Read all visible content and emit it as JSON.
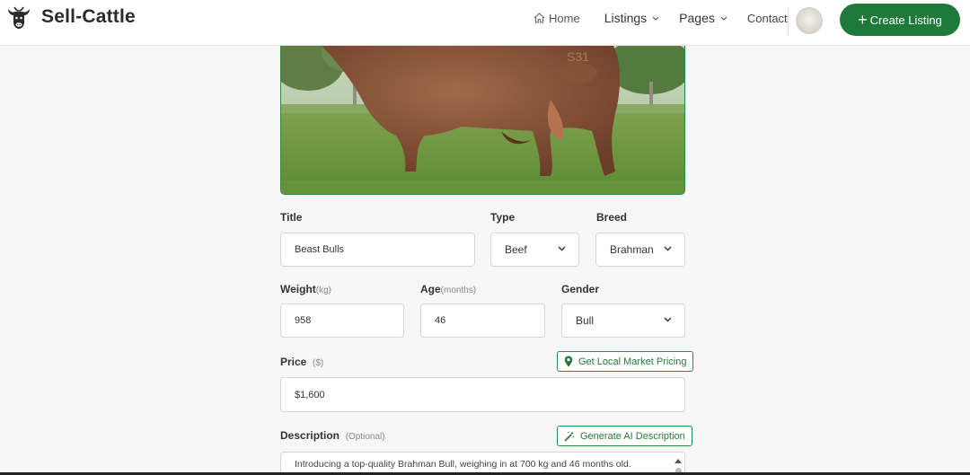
{
  "app": {
    "name": "Sell-Cattle"
  },
  "nav": {
    "home": "Home",
    "listings": "Listings",
    "pages": "Pages",
    "contact": "Contact",
    "create_listing": "Create Listing"
  },
  "form": {
    "title": {
      "label": "Title",
      "value": "Beast Bulls"
    },
    "type": {
      "label": "Type",
      "value": "Beef"
    },
    "breed": {
      "label": "Breed",
      "value": "Brahman"
    },
    "weight": {
      "label": "Weight",
      "unit": "(kg)",
      "value": "958"
    },
    "age": {
      "label": "Age",
      "unit": "(months)",
      "value": "46"
    },
    "gender": {
      "label": "Gender",
      "value": "Bull"
    },
    "price": {
      "label": "Price",
      "unit": "($)",
      "value": "$1,600",
      "market_button": "Get Local Market Pricing"
    },
    "description": {
      "label": "Description",
      "optional": "(Optional)",
      "ai_button": "Generate AI Description",
      "value": "Introducing a top-quality Brahman Bull, weighing in at 700 kg and 46 months old. Known for their heat tolerance, disease resistance, and overall hardiness, Brahman"
    }
  },
  "icons": {
    "logo": "cow-head-icon",
    "home": "home-icon",
    "listings_caret": "chevron-down-icon",
    "pages_caret": "chevron-down-icon",
    "plus": "plus-icon",
    "map_pin": "map-pin-icon",
    "magic_wand": "magic-wand-icon"
  },
  "colors": {
    "brand_green": "#1f7a3a",
    "outline_green": "#2b8a44"
  }
}
